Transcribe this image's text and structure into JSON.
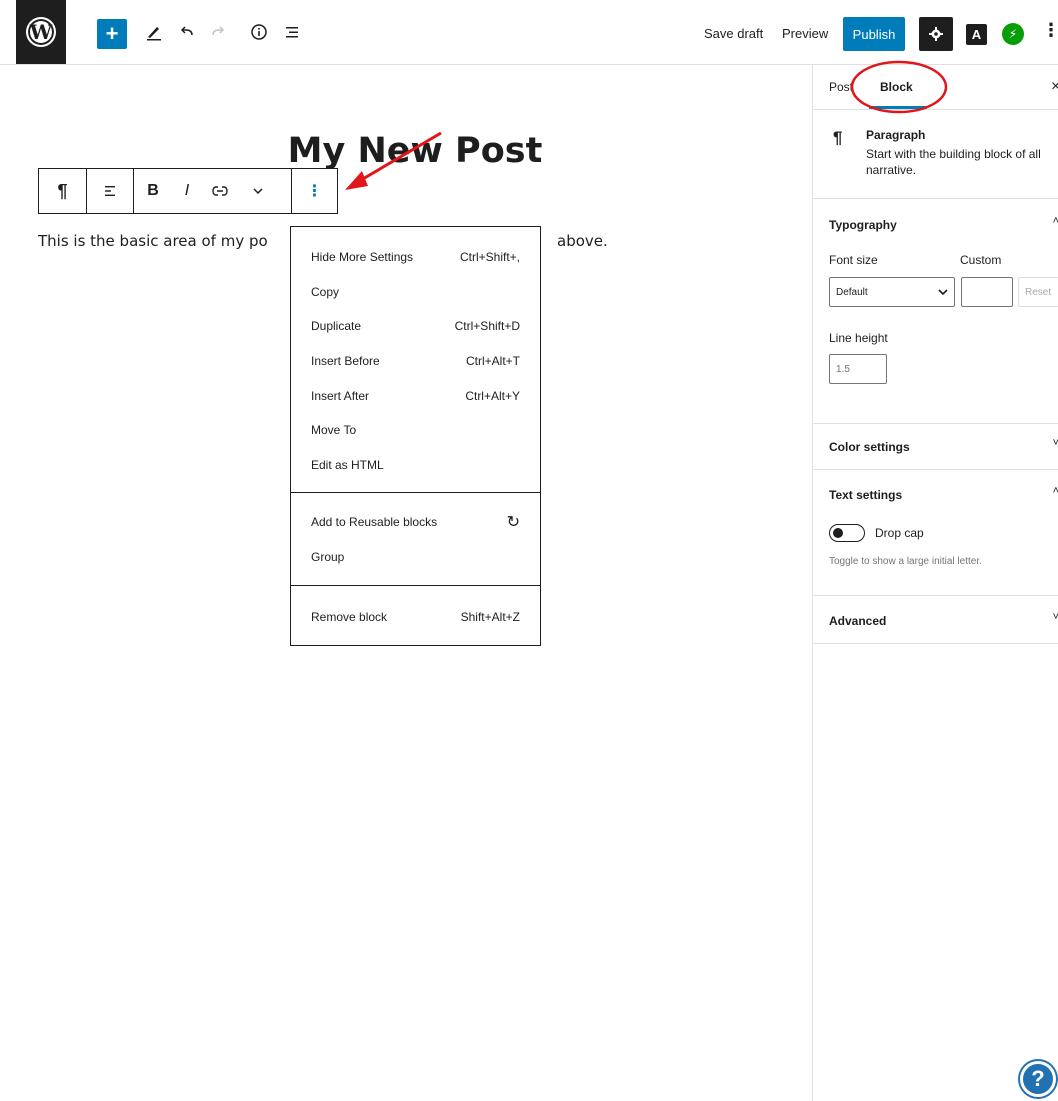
{
  "header": {
    "logo_letter": "W",
    "add_symbol": "+",
    "save_draft": "Save draft",
    "preview": "Preview",
    "publish": "Publish",
    "a_label": "A",
    "jetpack_symbol": "⚡",
    "more_symbol": "⋮",
    "icons": [
      "add-block-icon",
      "edit-tools-icon",
      "undo-icon",
      "redo-icon",
      "details-info-icon",
      "list-view-icon",
      "settings-gear-icon",
      "a-plugin-icon",
      "jetpack-icon",
      "more-options-icon"
    ]
  },
  "editor": {
    "title": "My New Post",
    "paragraph_start": "This is the basic area of my po",
    "paragraph_end": "above.",
    "block_toolbar": {
      "paragraph_symbol": "¶",
      "align_symbol": "≡",
      "bold": "B",
      "italic": "I",
      "link_symbol": "⚯",
      "more_rich_symbol": "⌄",
      "options_symbol": "⋮"
    }
  },
  "dropdown": {
    "items": [
      {
        "label": "Hide More Settings",
        "shortcut": "Ctrl+Shift+,"
      },
      {
        "label": "Copy",
        "shortcut": ""
      },
      {
        "label": "Duplicate",
        "shortcut": "Ctrl+Shift+D"
      },
      {
        "label": "Insert Before",
        "shortcut": "Ctrl+Alt+T"
      },
      {
        "label": "Insert After",
        "shortcut": "Ctrl+Alt+Y"
      },
      {
        "label": "Move To",
        "shortcut": ""
      },
      {
        "label": "Edit as HTML",
        "shortcut": ""
      }
    ],
    "reusable": {
      "label": "Add to Reusable blocks",
      "icon": "↻"
    },
    "group": {
      "label": "Group"
    },
    "remove": {
      "label": "Remove block",
      "shortcut": "Shift+Alt+Z"
    }
  },
  "sidebar": {
    "tabs": [
      "Post",
      "Block"
    ],
    "close_symbol": "×",
    "block_info": {
      "symbol": "¶",
      "name": "Paragraph",
      "description_line1": "Start with the building block of all",
      "description_line2": "narrative."
    },
    "typography": {
      "heading": "Typography",
      "font_size_label": "Font size",
      "custom_label": "Custom",
      "font_size_value": "Default",
      "reset": "Reset",
      "line_height_label": "Line height",
      "line_height_value": "1.5"
    },
    "color_settings": {
      "heading": "Color settings"
    },
    "text_settings": {
      "heading": "Text settings",
      "drop_cap_label": "Drop cap",
      "drop_cap_help": "Toggle to show a large initial letter."
    },
    "advanced": {
      "heading": "Advanced"
    },
    "chevron_up": "˄",
    "chevron_down": "˅"
  },
  "help": {
    "symbol": "?"
  },
  "colors": {
    "accent": "#007cba",
    "annotation_red": "#e0161b",
    "dark": "#1e1e1e",
    "jetpack_green": "#069e08"
  }
}
